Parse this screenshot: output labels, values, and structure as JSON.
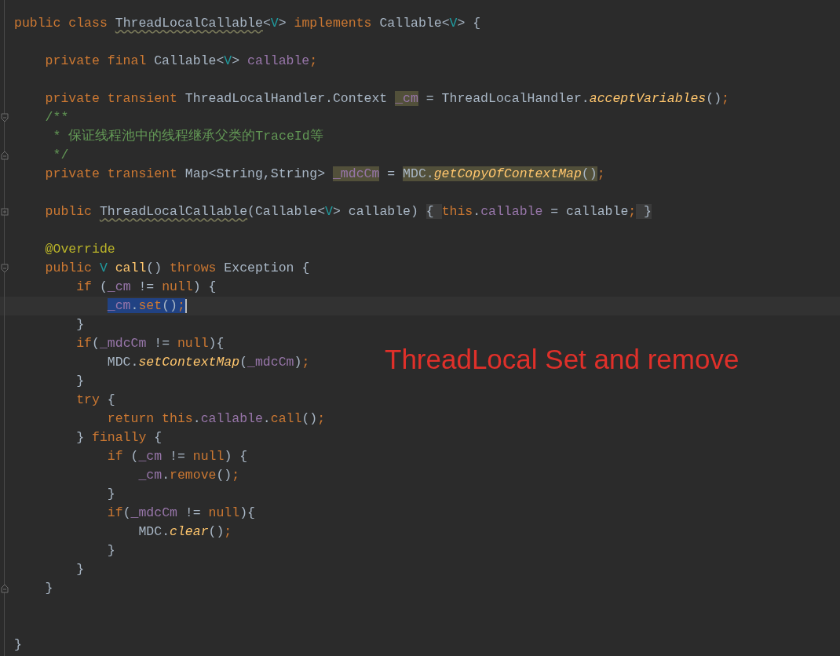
{
  "editor": {
    "annotation": "ThreadLocal Set and remove",
    "lines": [
      {
        "kind": "code",
        "tokens": [
          {
            "text": "public class ",
            "kind": "kw"
          },
          {
            "text": "ThreadLocalCallable",
            "kind": "warn"
          },
          {
            "text": "<",
            "kind": "plain"
          },
          {
            "text": "V",
            "kind": "generic"
          },
          {
            "text": "> ",
            "kind": "plain"
          },
          {
            "text": "implements ",
            "kind": "kw"
          },
          {
            "text": "Callable<",
            "kind": "plain"
          },
          {
            "text": "V",
            "kind": "generic"
          },
          {
            "text": "> {",
            "kind": "plain"
          }
        ],
        "children": [
          {
            "kind": "blank"
          },
          {
            "kind": "code",
            "tokens": [
              {
                "text": "private final ",
                "kind": "kw"
              },
              {
                "text": "Callable<",
                "kind": "plain"
              },
              {
                "text": "V",
                "kind": "generic"
              },
              {
                "text": "> ",
                "kind": "plain"
              },
              {
                "text": "callable",
                "kind": "field"
              },
              {
                "text": ";",
                "kind": "kw"
              }
            ]
          },
          {
            "kind": "blank"
          },
          {
            "kind": "code",
            "tokens": [
              {
                "text": "private transient ",
                "kind": "kw"
              },
              {
                "text": "ThreadLocalHandler.Context ",
                "kind": "plain"
              },
              {
                "text": "_cm",
                "kind": "field",
                "highlight": true
              },
              {
                "text": " = ThreadLocalHandler.",
                "kind": "plain"
              },
              {
                "text": "acceptVariables",
                "kind": "static"
              },
              {
                "text": "()",
                "kind": "plain"
              },
              {
                "text": ";",
                "kind": "kw"
              }
            ]
          },
          {
            "kind": "code",
            "fold_start": true,
            "tokens": [
              {
                "text": "/**",
                "kind": "doc"
              }
            ]
          },
          {
            "kind": "comment_body",
            "tokens": [
              {
                "text": "* 保证线程池中的线程继承父类的TraceId等",
                "kind": "doc"
              }
            ]
          },
          {
            "kind": "comment_body",
            "fold_end": true,
            "tokens": [
              {
                "text": "*/",
                "kind": "doc"
              }
            ]
          },
          {
            "kind": "code",
            "tokens": [
              {
                "text": "private transient ",
                "kind": "kw"
              },
              {
                "text": "Map<String,String> ",
                "kind": "plain"
              },
              {
                "text": "_mdcCm",
                "kind": "field",
                "highlight": true
              },
              {
                "text": " = ",
                "kind": "plain"
              },
              {
                "text": "MDC.",
                "kind": "plain",
                "highlight": true
              },
              {
                "text": "getCopyOfContextMap",
                "kind": "static",
                "highlight": true
              },
              {
                "text": "()",
                "kind": "plain",
                "highlight": true
              },
              {
                "text": ";",
                "kind": "kw"
              }
            ]
          },
          {
            "kind": "blank"
          },
          {
            "kind": "code",
            "folded": true,
            "tokens": [
              {
                "text": "public ",
                "kind": "kw"
              },
              {
                "text": "ThreadLocalCallable",
                "kind": "warn"
              },
              {
                "text": "(Callable<",
                "kind": "plain"
              },
              {
                "text": "V",
                "kind": "generic"
              },
              {
                "text": "> callable) ",
                "kind": "plain"
              },
              {
                "text": "{ ",
                "kind": "folded"
              },
              {
                "text": "this",
                "kind": "kw"
              },
              {
                "text": ".",
                "kind": "plain"
              },
              {
                "text": "callable",
                "kind": "field"
              },
              {
                "text": " = callable",
                "kind": "plain"
              },
              {
                "text": ";",
                "kind": "kw"
              },
              {
                "text": " }",
                "kind": "folded"
              }
            ]
          },
          {
            "kind": "blank"
          },
          {
            "kind": "code",
            "tokens": [
              {
                "text": "@Override",
                "kind": "annotation"
              }
            ]
          },
          {
            "kind": "code",
            "fold_start": true,
            "tokens": [
              {
                "text": "public ",
                "kind": "kw"
              },
              {
                "text": "V ",
                "kind": "generic"
              },
              {
                "text": "call",
                "kind": "method"
              },
              {
                "text": "() ",
                "kind": "plain"
              },
              {
                "text": "throws ",
                "kind": "kw"
              },
              {
                "text": "Exception {",
                "kind": "plain"
              }
            ],
            "children": [
              {
                "kind": "code",
                "tokens": [
                  {
                    "text": "if ",
                    "kind": "kw"
                  },
                  {
                    "text": "(",
                    "kind": "plain"
                  },
                  {
                    "text": "_cm",
                    "kind": "field"
                  },
                  {
                    "text": " != ",
                    "kind": "plain"
                  },
                  {
                    "text": "null",
                    "kind": "kw"
                  },
                  {
                    "text": ") {",
                    "kind": "plain"
                  }
                ],
                "children": [
                  {
                    "kind": "code",
                    "current": true,
                    "tokens": [
                      {
                        "text": "_cm",
                        "kind": "field",
                        "selected": true
                      },
                      {
                        "text": ".",
                        "kind": "plain",
                        "selected": true
                      },
                      {
                        "text": "set",
                        "kind": "kw",
                        "selected": true
                      },
                      {
                        "text": "()",
                        "kind": "plain",
                        "selected": true
                      },
                      {
                        "text": ";",
                        "kind": "kw",
                        "selected": true
                      }
                    ]
                  }
                ]
              },
              {
                "kind": "code",
                "tokens": [
                  {
                    "text": "}",
                    "kind": "plain"
                  }
                ]
              },
              {
                "kind": "code",
                "tokens": [
                  {
                    "text": "if",
                    "kind": "kw"
                  },
                  {
                    "text": "(",
                    "kind": "plain"
                  },
                  {
                    "text": "_mdcCm",
                    "kind": "field"
                  },
                  {
                    "text": " != ",
                    "kind": "plain"
                  },
                  {
                    "text": "null",
                    "kind": "kw"
                  },
                  {
                    "text": "){",
                    "kind": "plain"
                  }
                ],
                "children": [
                  {
                    "kind": "code",
                    "tokens": [
                      {
                        "text": "MDC.",
                        "kind": "plain"
                      },
                      {
                        "text": "setContextMap",
                        "kind": "static"
                      },
                      {
                        "text": "(",
                        "kind": "plain"
                      },
                      {
                        "text": "_mdcCm",
                        "kind": "field"
                      },
                      {
                        "text": ")",
                        "kind": "plain"
                      },
                      {
                        "text": ";",
                        "kind": "kw"
                      }
                    ]
                  }
                ]
              },
              {
                "kind": "code",
                "tokens": [
                  {
                    "text": "}",
                    "kind": "plain"
                  }
                ]
              },
              {
                "kind": "code",
                "tokens": [
                  {
                    "text": "try ",
                    "kind": "kw"
                  },
                  {
                    "text": "{",
                    "kind": "plain"
                  }
                ],
                "children": [
                  {
                    "kind": "code",
                    "tokens": [
                      {
                        "text": "return this",
                        "kind": "kw"
                      },
                      {
                        "text": ".",
                        "kind": "plain"
                      },
                      {
                        "text": "callable",
                        "kind": "field"
                      },
                      {
                        "text": ".",
                        "kind": "plain"
                      },
                      {
                        "text": "call",
                        "kind": "kw"
                      },
                      {
                        "text": "()",
                        "kind": "plain"
                      },
                      {
                        "text": ";",
                        "kind": "kw"
                      }
                    ]
                  }
                ]
              },
              {
                "kind": "code",
                "tokens": [
                  {
                    "text": "} ",
                    "kind": "plain"
                  },
                  {
                    "text": "finally ",
                    "kind": "kw"
                  },
                  {
                    "text": "{",
                    "kind": "plain"
                  }
                ],
                "children": [
                  {
                    "kind": "code",
                    "tokens": [
                      {
                        "text": "if ",
                        "kind": "kw"
                      },
                      {
                        "text": "(",
                        "kind": "plain"
                      },
                      {
                        "text": "_cm",
                        "kind": "field"
                      },
                      {
                        "text": " != ",
                        "kind": "plain"
                      },
                      {
                        "text": "null",
                        "kind": "kw"
                      },
                      {
                        "text": ") {",
                        "kind": "plain"
                      }
                    ],
                    "children": [
                      {
                        "kind": "code",
                        "tokens": [
                          {
                            "text": "_cm",
                            "kind": "field"
                          },
                          {
                            "text": ".",
                            "kind": "plain"
                          },
                          {
                            "text": "remove",
                            "kind": "kw"
                          },
                          {
                            "text": "()",
                            "kind": "plain"
                          },
                          {
                            "text": ";",
                            "kind": "kw"
                          }
                        ]
                      }
                    ]
                  },
                  {
                    "kind": "code",
                    "tokens": [
                      {
                        "text": "}",
                        "kind": "plain"
                      }
                    ]
                  },
                  {
                    "kind": "code",
                    "tokens": [
                      {
                        "text": "if",
                        "kind": "kw"
                      },
                      {
                        "text": "(",
                        "kind": "plain"
                      },
                      {
                        "text": "_mdcCm",
                        "kind": "field"
                      },
                      {
                        "text": " != ",
                        "kind": "plain"
                      },
                      {
                        "text": "null",
                        "kind": "kw"
                      },
                      {
                        "text": "){",
                        "kind": "plain"
                      }
                    ],
                    "children": [
                      {
                        "kind": "code",
                        "tokens": [
                          {
                            "text": "MDC.",
                            "kind": "plain"
                          },
                          {
                            "text": "clear",
                            "kind": "static"
                          },
                          {
                            "text": "()",
                            "kind": "plain"
                          },
                          {
                            "text": ";",
                            "kind": "kw"
                          }
                        ]
                      }
                    ]
                  },
                  {
                    "kind": "code",
                    "tokens": [
                      {
                        "text": "}",
                        "kind": "plain"
                      }
                    ]
                  }
                ]
              },
              {
                "kind": "code",
                "tokens": [
                  {
                    "text": "}",
                    "kind": "plain"
                  }
                ]
              }
            ]
          },
          {
            "kind": "code",
            "fold_end": true,
            "tokens": [
              {
                "text": "}",
                "kind": "plain"
              }
            ]
          },
          {
            "kind": "blank"
          },
          {
            "kind": "blank"
          }
        ]
      },
      {
        "kind": "code",
        "tokens": [
          {
            "text": "}",
            "kind": "plain"
          }
        ]
      }
    ]
  }
}
